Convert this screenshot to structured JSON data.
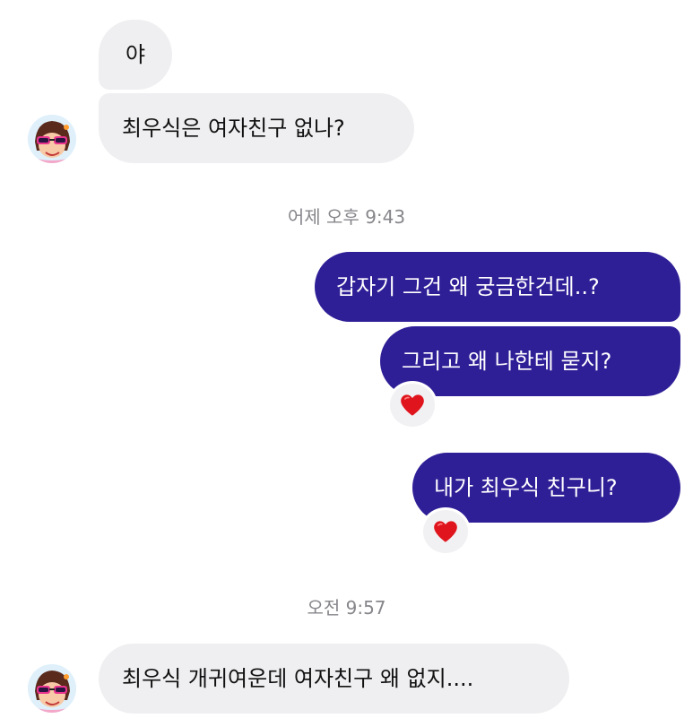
{
  "messages": [
    {
      "side": "in",
      "text": "야"
    },
    {
      "side": "in",
      "text": "최우식은 여자친구 없나?"
    },
    {
      "side": "out",
      "text": "갑자기 그건 왜 궁금한건데..?"
    },
    {
      "side": "out",
      "text": "그리고 왜 나한테 묻지?",
      "reaction": "heart-icon"
    },
    {
      "side": "out",
      "text": "내가 최우식 친구니?",
      "reaction": "heart-icon"
    },
    {
      "side": "in",
      "text": "최우식 개귀여운데 여자친구 왜 없지...."
    }
  ],
  "timestamps": [
    "어제 오후 9:43",
    "오전 9:57"
  ],
  "colors": {
    "outgoing_bubble": "#2f1f97",
    "incoming_bubble": "#efeff1",
    "timestamp_text": "#86868b",
    "reaction_heart": "#e0141d"
  }
}
